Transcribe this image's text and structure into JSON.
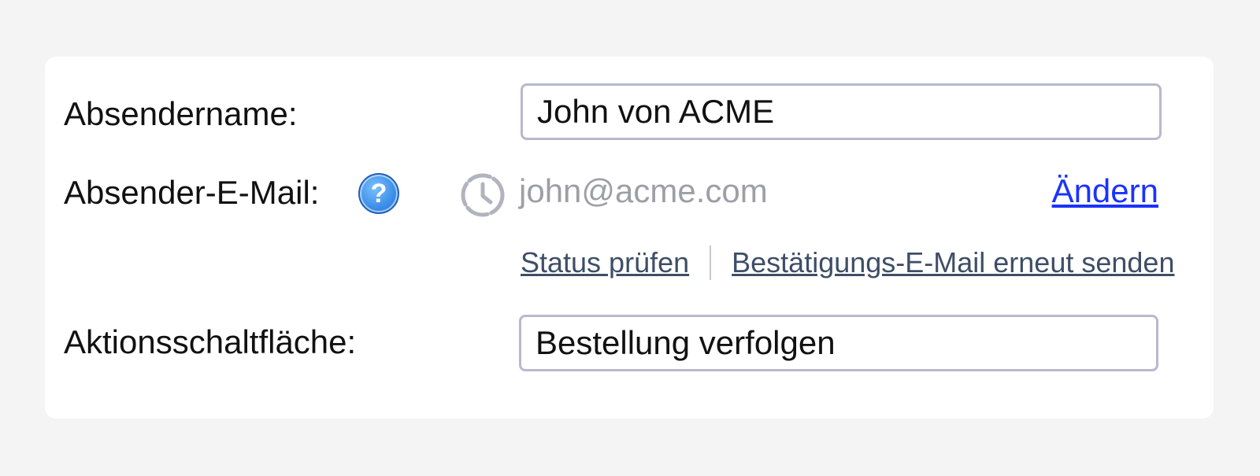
{
  "form": {
    "sender_name": {
      "label": "Absendername:",
      "value": "John von ACME"
    },
    "sender_email": {
      "label": "Absender-E-Mail:",
      "help_icon": "question-icon",
      "help_glyph": "?",
      "status_icon": "clock-icon",
      "value": "john@acme.com",
      "change_label": "Ändern",
      "check_status_label": "Status prüfen",
      "resend_label": "Bestätigungs-E-Mail erneut senden"
    },
    "action_button": {
      "label": "Aktionsschaltfläche:",
      "value": "Bestellung verfolgen"
    }
  },
  "colors": {
    "link": "#1a33ff",
    "sublink": "#3e4e66",
    "muted": "#9e9ea6",
    "help_blue": "#3a8ee8",
    "field_border": "#b9b8cc"
  }
}
